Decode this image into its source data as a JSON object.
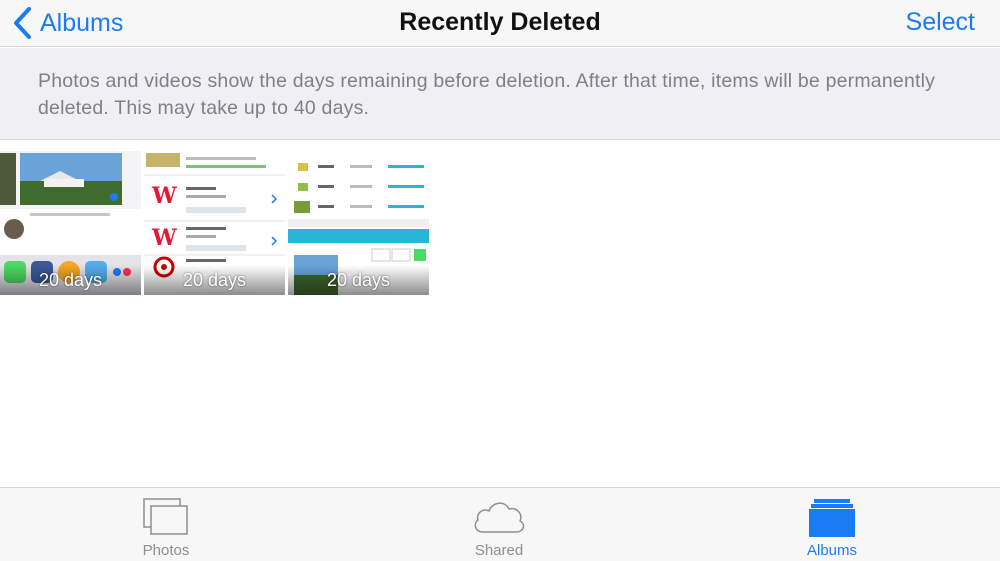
{
  "nav": {
    "back_label": "Albums",
    "title": "Recently Deleted",
    "select_label": "Select"
  },
  "banner": {
    "text": "Photos and videos show the days remaining before deletion. After that time, items will be permanently deleted. This may take up to 40 days."
  },
  "items": [
    {
      "days": "20 days",
      "kind": "share-sheet-screenshot"
    },
    {
      "days": "20 days",
      "kind": "store-list-screenshot"
    },
    {
      "days": "20 days",
      "kind": "print-options-screenshot"
    }
  ],
  "tabs": [
    {
      "label": "Photos",
      "icon": "photos-stack-icon",
      "active": false
    },
    {
      "label": "Shared",
      "icon": "cloud-icon",
      "active": false
    },
    {
      "label": "Albums",
      "icon": "albums-folder-icon",
      "active": true
    }
  ],
  "colors": {
    "accent": "#1a7cf5",
    "inactive": "#8e8e93",
    "banner_bg": "#efeff4"
  }
}
